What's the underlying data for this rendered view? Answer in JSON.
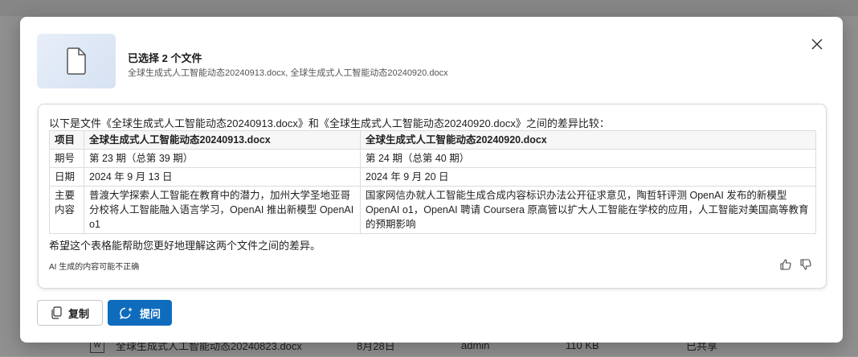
{
  "background": {
    "row": {
      "icon": "word-doc-icon",
      "name": "全球生成式人工智能动态20240823.docx",
      "date": "8月28日",
      "owner": "admin",
      "size": "110 KB",
      "sharing": "已共享"
    }
  },
  "dialog": {
    "selected_title": "已选择 2 个文件",
    "selected_files": "全球生成式人工智能动态20240913.docx, 全球生成式人工智能动态20240920.docx",
    "close_icon": "close-icon",
    "response": {
      "intro": "以下是文件《全球生成式人工智能动态20240913.docx》和《全球生成式人工智能动态20240920.docx》之间的差异比较：",
      "table": {
        "headers": [
          "项目",
          "全球生成式人工智能动态20240913.docx",
          "全球生成式人工智能动态20240920.docx"
        ],
        "rows": [
          [
            "期号",
            "第 23 期（总第 39 期）",
            "第 24 期（总第 40 期）"
          ],
          [
            "日期",
            "2024 年 9 月 13 日",
            "2024 年 9 月 20 日"
          ],
          [
            "主要内容",
            "普渡大学探索人工智能在教育中的潜力，加州大学圣地亚哥分校将人工智能融入语言学习，OpenAI 推出新模型 OpenAI o1",
            "国家网信办就人工智能生成合成内容标识办法公开征求意见，陶哲轩评测 OpenAI 发布的新模型 OpenAI o1，OpenAI 聘请 Coursera 原高管以扩大人工智能在学校的应用，人工智能对美国高等教育的预期影响"
          ]
        ]
      },
      "outro": "希望这个表格能帮助您更好地理解这两个文件之间的差异。",
      "disclaimer": "AI 生成的内容可能不正确"
    },
    "buttons": {
      "copy_label": "复制",
      "ask_label": "提问"
    },
    "colors": {
      "primary": "#0f6cbd",
      "border": "#d9d9d9"
    }
  }
}
